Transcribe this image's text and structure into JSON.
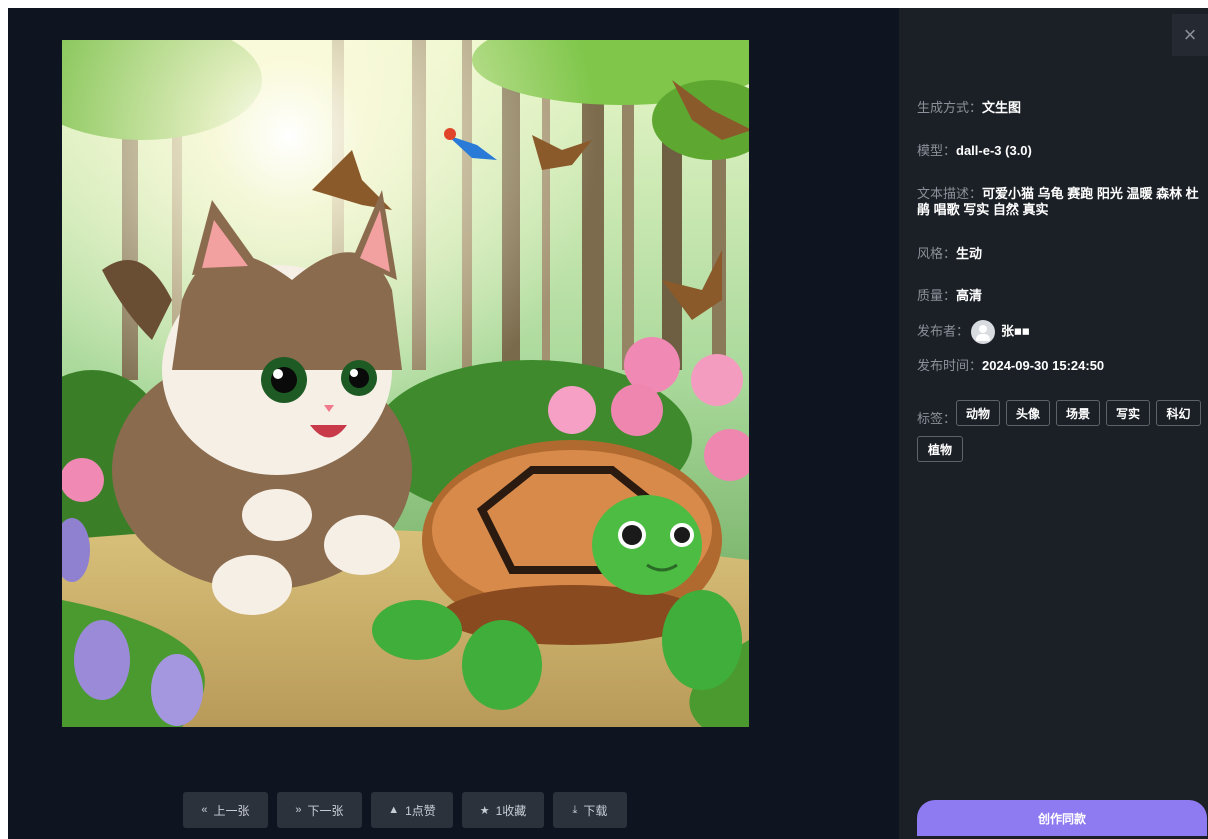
{
  "toolbar": {
    "prev_label": "上一张",
    "prev_icon": "«",
    "next_label": "下一张",
    "next_icon": "»",
    "like_label": "1点赞",
    "like_icon": "▲",
    "fav_label": "1收藏",
    "fav_icon": "★",
    "download_label": "下载",
    "download_icon": "⤓"
  },
  "close_icon": "×",
  "details": {
    "mode_label": "生成方式：",
    "mode_value": "文生图",
    "model_label": "模型：",
    "model_value": "dall-e-3 (3.0)",
    "prompt_label": "文本描述：",
    "prompt_value": "可爱小猫 乌龟 赛跑 阳光 温暖 森林 杜鹃 唱歌 写实 自然 真实",
    "style_label": "风格：",
    "style_value": "生动",
    "quality_label": "质量：",
    "quality_value": "高清",
    "publisher_label": "发布者：",
    "publisher_value": "张■■",
    "time_label": "发布时间：",
    "time_value": "2024-09-30 15:24:50",
    "tags_label": "标签：",
    "tags": [
      "动物",
      "头像",
      "场景",
      "写实",
      "科幻",
      "植物"
    ]
  },
  "create_button": "创作同款",
  "colors": {
    "accent": "#8f7bf1",
    "panel": "#1b1f26",
    "stage": "#0f1520"
  }
}
